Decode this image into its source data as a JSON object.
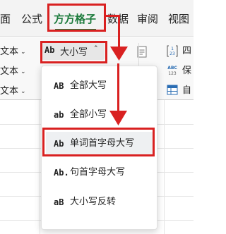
{
  "menu_tabs": {
    "page": "面",
    "formula": "公式",
    "active": "方方格子",
    "data": "数据",
    "review": "审阅",
    "view": "视图"
  },
  "ribbon": {
    "rows": [
      "文本",
      "文本",
      "文本"
    ],
    "case_button": {
      "icon": "Ab",
      "label": "大小写"
    },
    "right_labels": [
      "四",
      "保",
      "自"
    ]
  },
  "case_menu": {
    "items": [
      {
        "icon": "AB",
        "label": "全部大写"
      },
      {
        "icon": "ab",
        "label": "全部小写"
      },
      {
        "icon": "Ab",
        "label": "单词首字母大写"
      },
      {
        "icon": "Ab.",
        "label": "句首字母大写"
      },
      {
        "icon": "aB",
        "label": "大小写反转"
      }
    ],
    "selected_index": 2
  },
  "colors": {
    "accent": "#1c7b3c",
    "annotation": "#d92121"
  }
}
